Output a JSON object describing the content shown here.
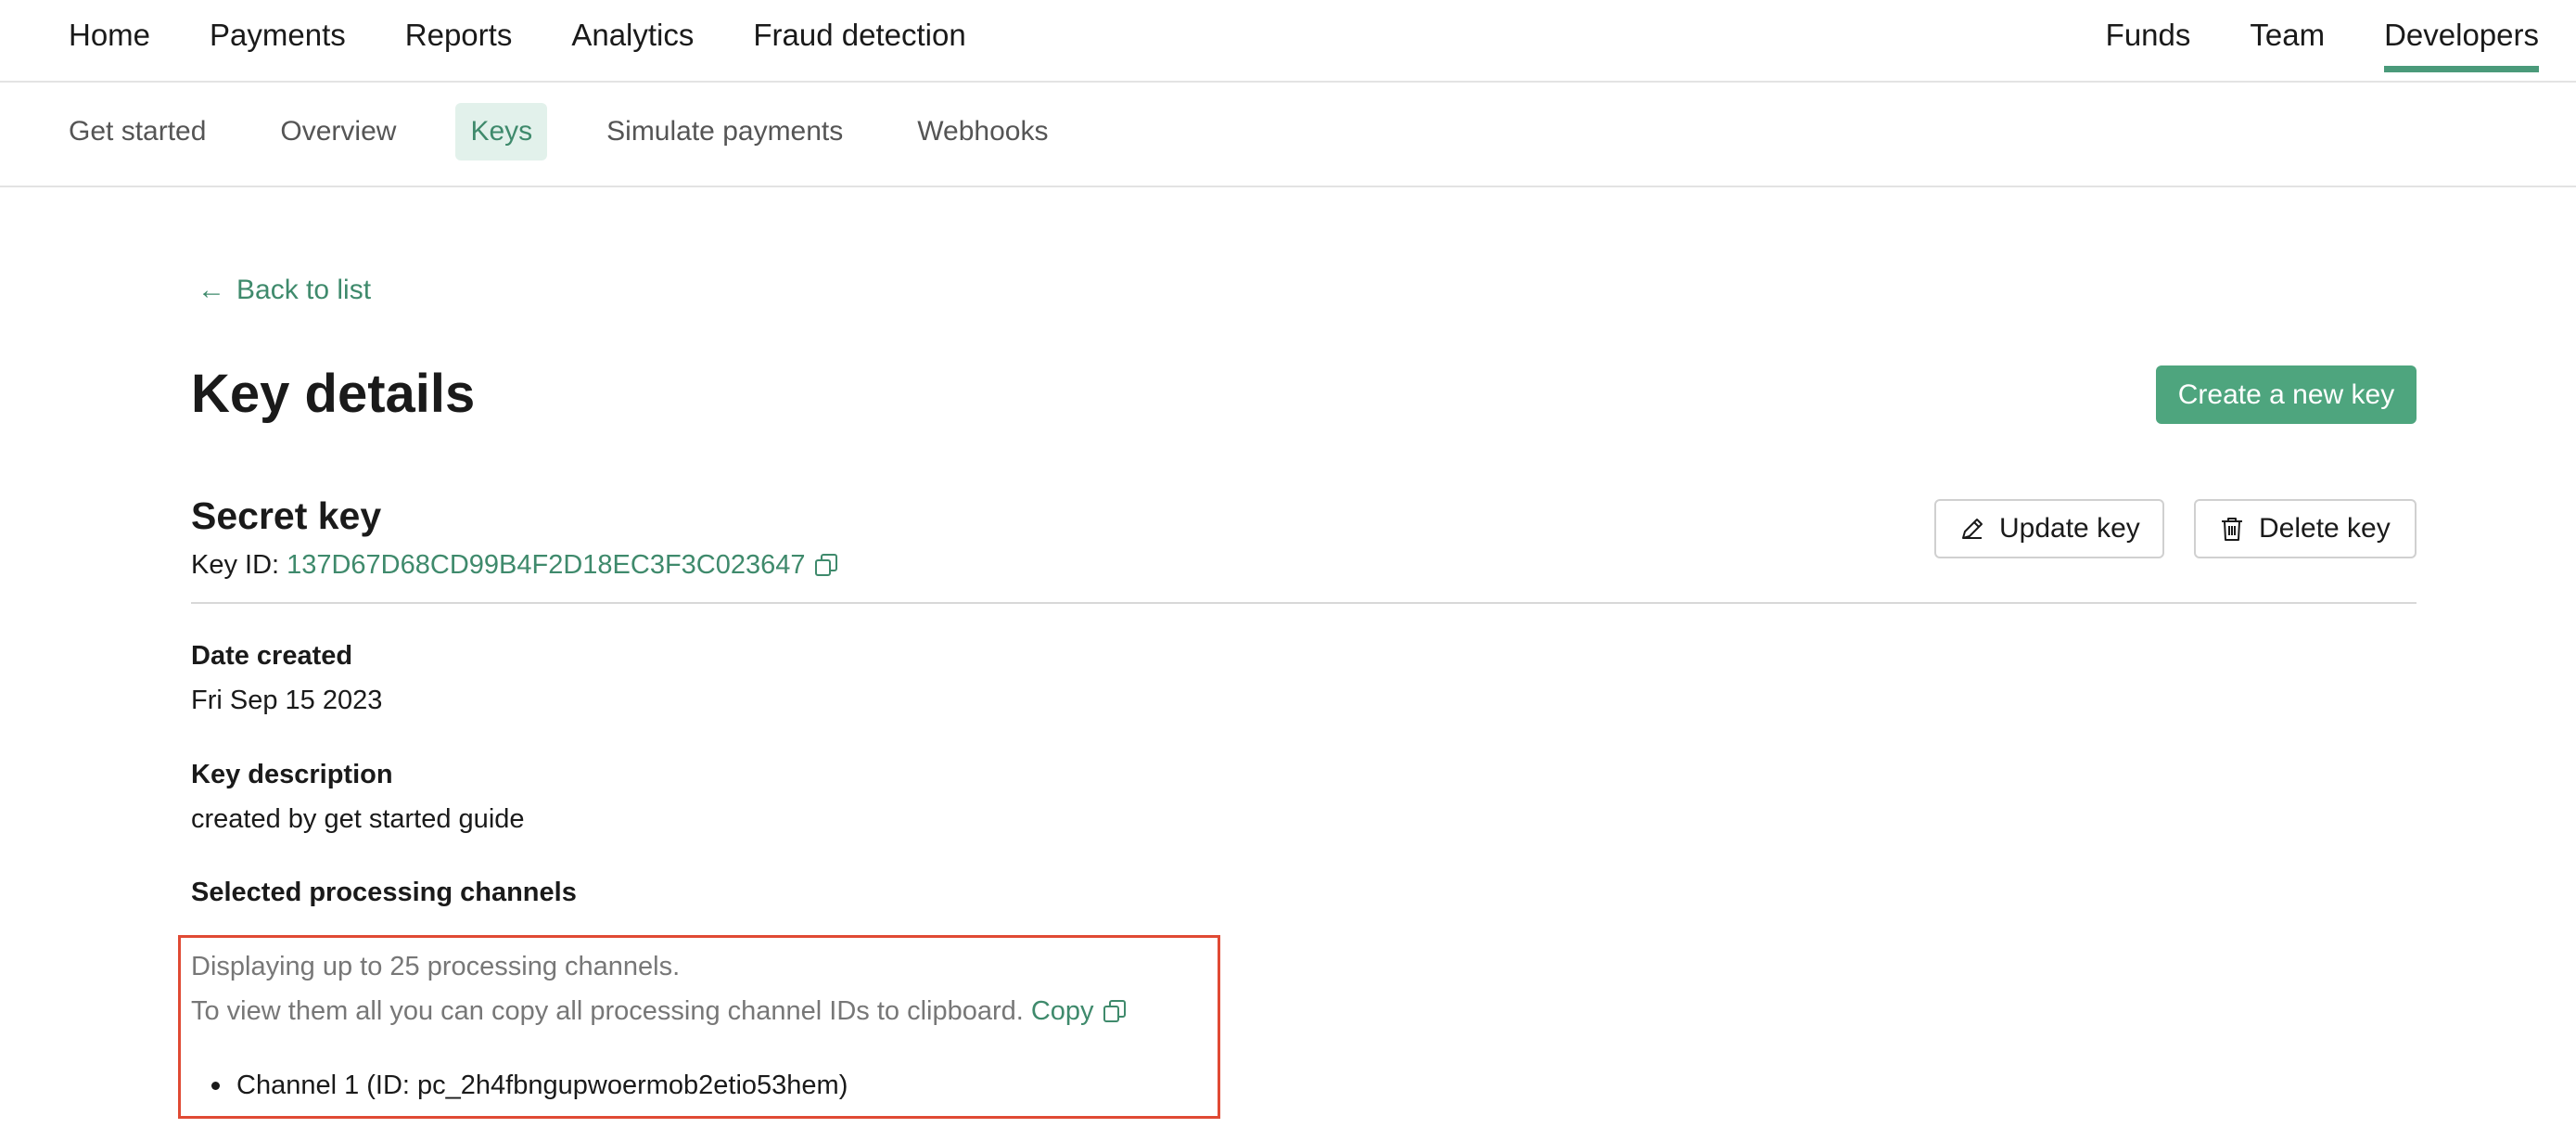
{
  "top_nav": {
    "left_items": [
      {
        "label": "Home"
      },
      {
        "label": "Payments"
      },
      {
        "label": "Reports"
      },
      {
        "label": "Analytics"
      },
      {
        "label": "Fraud detection"
      }
    ],
    "right_items": [
      {
        "label": "Funds"
      },
      {
        "label": "Team"
      },
      {
        "label": "Developers",
        "active": true
      }
    ]
  },
  "sub_nav": {
    "items": [
      {
        "label": "Get started"
      },
      {
        "label": "Overview"
      },
      {
        "label": "Keys",
        "active": true
      },
      {
        "label": "Simulate payments"
      },
      {
        "label": "Webhooks"
      }
    ]
  },
  "back_link": {
    "arrow": "←",
    "label": "Back to list"
  },
  "page": {
    "title": "Key details",
    "create_button": "Create a new key"
  },
  "key": {
    "name": "Secret key",
    "id_label": "Key ID:",
    "id_value": "137D67D68CD99B4F2D18EC3F3C023647",
    "update_button": "Update key",
    "delete_button": "Delete key"
  },
  "fields": {
    "date_created_label": "Date created",
    "date_created_value": "Fri Sep 15 2023",
    "description_label": "Key description",
    "description_value": "created by get started guide",
    "channels_label": "Selected processing channels"
  },
  "channels": {
    "note_line1": "Displaying up to 25 processing channels.",
    "note_line2": "To view them all you can copy all processing channel IDs to clipboard.",
    "copy_label": "Copy",
    "items": [
      {
        "text": "Channel 1 (ID: pc_2h4fbngupwoermob2etio53hem)"
      }
    ]
  },
  "colors": {
    "accent": "#4ea57e",
    "accent_text": "#3f8a6c",
    "highlight_border": "#e04a34"
  },
  "icons": {
    "copy": "copy-icon",
    "pencil": "pencil-icon",
    "trash": "trash-icon",
    "back_arrow": "arrow-left-icon"
  }
}
